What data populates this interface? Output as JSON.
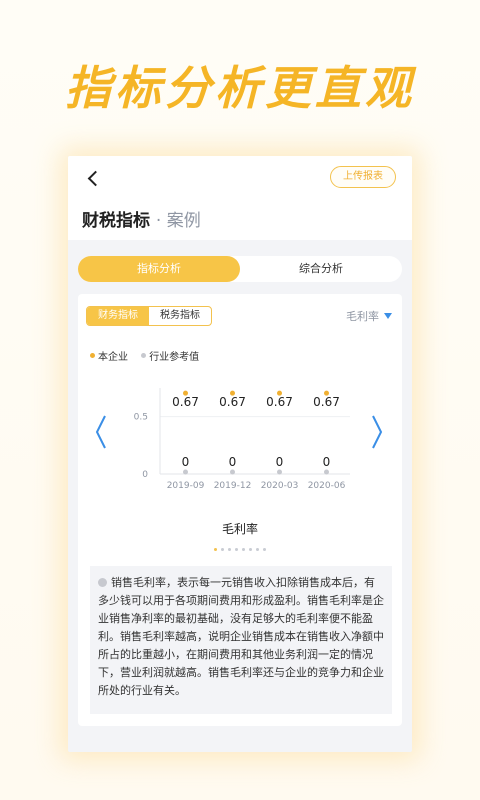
{
  "headline": "指标分析更直观",
  "header": {
    "title": "财税指标",
    "subtitle": "· 案例",
    "upload_label": "上传报表"
  },
  "tabs": [
    {
      "label": "指标分析",
      "active": true
    },
    {
      "label": "综合分析",
      "active": false
    }
  ],
  "segments": [
    {
      "label": "财务指标",
      "active": true
    },
    {
      "label": "税务指标",
      "active": false
    }
  ],
  "metric_select": "毛利率",
  "legend": [
    {
      "label": "本企业",
      "color": "#f0b032"
    },
    {
      "label": "行业参考值",
      "color": "#c7c9cf"
    }
  ],
  "chart_data": {
    "type": "line",
    "x": [
      "2019-09",
      "2019-12",
      "2020-03",
      "2020-06"
    ],
    "yticks": [
      "0.5",
      "0"
    ],
    "ylim": [
      0,
      0.75
    ],
    "series": [
      {
        "name": "本企业",
        "values": [
          0.67,
          0.67,
          0.67,
          0.67
        ],
        "color": "#f0b032"
      },
      {
        "name": "行业参考值",
        "values": [
          0,
          0,
          0,
          0
        ],
        "color": "#c7c9cf"
      }
    ],
    "data_labels_top": [
      "0.67",
      "0.67",
      "0.67",
      "0.67"
    ],
    "data_labels_bottom": [
      "0",
      "0",
      "0",
      "0"
    ],
    "title": "毛利率"
  },
  "pager": {
    "count": 8,
    "active": 0
  },
  "description": "销售毛利率，表示每一元销售收入扣除销售成本后，有多少钱可以用于各项期间费用和形成盈利。销售毛利率是企业销售净利率的最初基础，没有足够大的毛利率便不能盈利。销售毛利率越高，说明企业销售成本在销售收入净额中所占的比重越小，在期间费用和其他业务利润一定的情况下，营业利润就越高。销售毛利率还与企业的竞争力和企业所处的行业有关。"
}
